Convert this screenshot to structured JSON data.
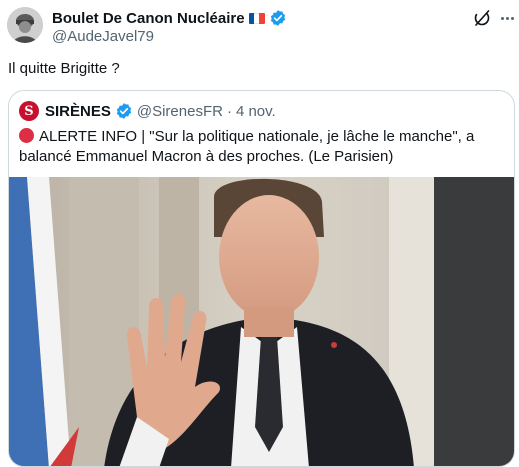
{
  "author": {
    "display_name": "Boulet De Canon Nucléaire",
    "handle": "@AudeJavel79",
    "avatar_icon": "helmeted-figure-avatar",
    "flag_icon": "france-flag-icon",
    "verified_icon": "verified-badge-icon"
  },
  "tweet": {
    "text": "Il quitte Brigitte ?"
  },
  "quoted": {
    "display_name": "SIRÈNES",
    "avatar_letter": "S",
    "handle": "@SirenesFR",
    "separator": "·",
    "date": "4 nov.",
    "text": "ALERTE INFO | \"Sur la politique nationale, je lâche le manche\", a balancé Emmanuel Macron à des proches. (Le Parisien)",
    "image_icon": "man-waving-photo"
  },
  "colors": {
    "verified_blue": "#1d9bf0",
    "alert_red": "#dd2e44",
    "sirenes_red": "#c8102e",
    "muted_text": "#536471",
    "border": "#cfd9de"
  }
}
